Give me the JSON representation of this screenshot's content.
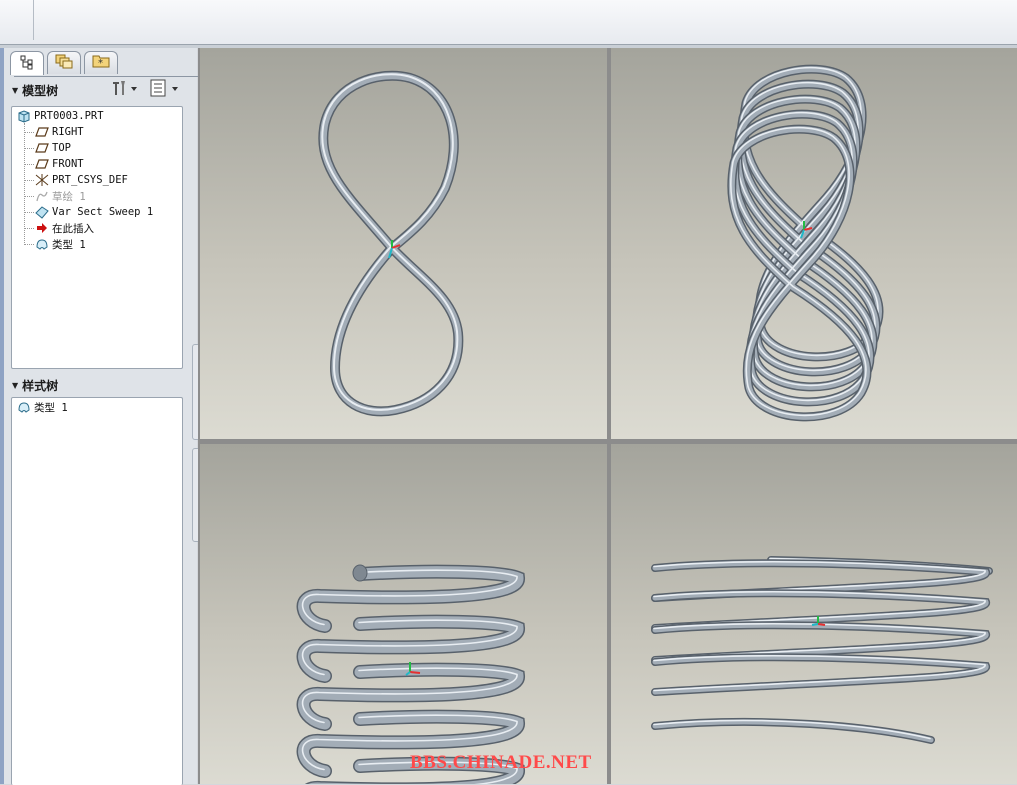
{
  "sidebar": {
    "tabs": [
      {
        "icon": "model-tree-icon"
      },
      {
        "icon": "folder-browser-icon"
      },
      {
        "icon": "favorites-icon"
      }
    ],
    "model_tree": {
      "title": "模型树",
      "tools": [
        "settings-icon",
        "show-icon"
      ],
      "items": [
        {
          "label": "PRT0003.PRT",
          "icon": "part-icon",
          "dim": false
        },
        {
          "label": "RIGHT",
          "icon": "datum-plane-icon",
          "dim": false
        },
        {
          "label": "TOP",
          "icon": "datum-plane-icon",
          "dim": false
        },
        {
          "label": "FRONT",
          "icon": "datum-plane-icon",
          "dim": false
        },
        {
          "label": "PRT_CSYS_DEF",
          "icon": "csys-icon",
          "dim": false
        },
        {
          "label": "草绘 1",
          "icon": "sketch-icon",
          "dim": true
        },
        {
          "label": "Var Sect Sweep 1",
          "icon": "sweep-icon",
          "dim": false
        },
        {
          "label": "在此插入",
          "icon": "insert-arrow-icon",
          "dim": false
        },
        {
          "label": "类型 1",
          "icon": "style-icon",
          "dim": false
        }
      ]
    },
    "style_tree": {
      "title": "样式树",
      "items": [
        {
          "label": "类型 1",
          "icon": "style-icon"
        }
      ]
    }
  },
  "viewports": {
    "top_left": {
      "shape": "figure-eight curve"
    },
    "top_right": {
      "shape": "figure-eight coil"
    },
    "bottom_left": {
      "shape": "coil side view"
    },
    "bottom_right": {
      "shape": "coil angled view"
    }
  },
  "colors": {
    "tube": "#a3adb7",
    "tube_highlight": "#e8edf2",
    "tube_shadow": "#58616b",
    "axis_x": "#e53030",
    "axis_y": "#22bb44",
    "axis_z": "#20b8c8"
  },
  "watermark": "BBS.CHINADE.NET"
}
